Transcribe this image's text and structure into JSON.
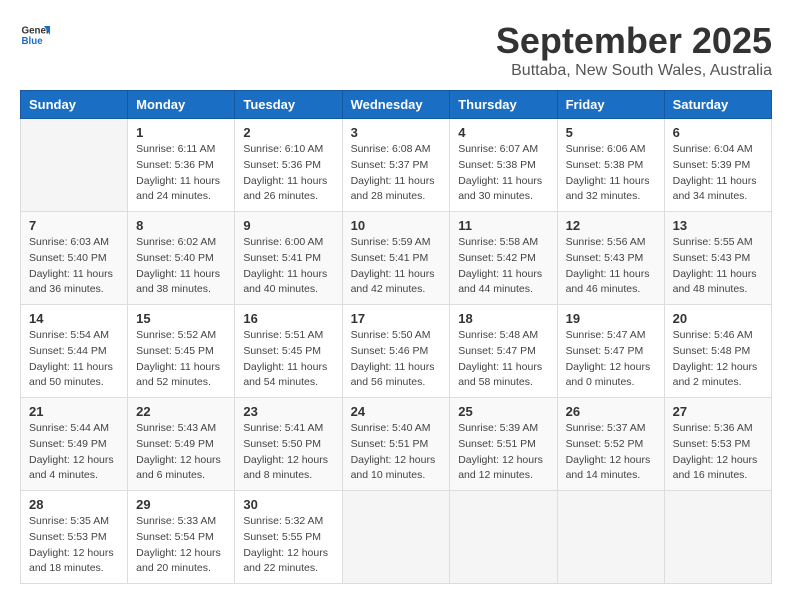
{
  "header": {
    "logo_general": "General",
    "logo_blue": "Blue",
    "month": "September 2025",
    "location": "Buttaba, New South Wales, Australia"
  },
  "weekdays": [
    "Sunday",
    "Monday",
    "Tuesday",
    "Wednesday",
    "Thursday",
    "Friday",
    "Saturday"
  ],
  "weeks": [
    [
      {
        "day": "",
        "sunrise": "",
        "sunset": "",
        "daylight": ""
      },
      {
        "day": "1",
        "sunrise": "Sunrise: 6:11 AM",
        "sunset": "Sunset: 5:36 PM",
        "daylight": "Daylight: 11 hours and 24 minutes."
      },
      {
        "day": "2",
        "sunrise": "Sunrise: 6:10 AM",
        "sunset": "Sunset: 5:36 PM",
        "daylight": "Daylight: 11 hours and 26 minutes."
      },
      {
        "day": "3",
        "sunrise": "Sunrise: 6:08 AM",
        "sunset": "Sunset: 5:37 PM",
        "daylight": "Daylight: 11 hours and 28 minutes."
      },
      {
        "day": "4",
        "sunrise": "Sunrise: 6:07 AM",
        "sunset": "Sunset: 5:38 PM",
        "daylight": "Daylight: 11 hours and 30 minutes."
      },
      {
        "day": "5",
        "sunrise": "Sunrise: 6:06 AM",
        "sunset": "Sunset: 5:38 PM",
        "daylight": "Daylight: 11 hours and 32 minutes."
      },
      {
        "day": "6",
        "sunrise": "Sunrise: 6:04 AM",
        "sunset": "Sunset: 5:39 PM",
        "daylight": "Daylight: 11 hours and 34 minutes."
      }
    ],
    [
      {
        "day": "7",
        "sunrise": "Sunrise: 6:03 AM",
        "sunset": "Sunset: 5:40 PM",
        "daylight": "Daylight: 11 hours and 36 minutes."
      },
      {
        "day": "8",
        "sunrise": "Sunrise: 6:02 AM",
        "sunset": "Sunset: 5:40 PM",
        "daylight": "Daylight: 11 hours and 38 minutes."
      },
      {
        "day": "9",
        "sunrise": "Sunrise: 6:00 AM",
        "sunset": "Sunset: 5:41 PM",
        "daylight": "Daylight: 11 hours and 40 minutes."
      },
      {
        "day": "10",
        "sunrise": "Sunrise: 5:59 AM",
        "sunset": "Sunset: 5:41 PM",
        "daylight": "Daylight: 11 hours and 42 minutes."
      },
      {
        "day": "11",
        "sunrise": "Sunrise: 5:58 AM",
        "sunset": "Sunset: 5:42 PM",
        "daylight": "Daylight: 11 hours and 44 minutes."
      },
      {
        "day": "12",
        "sunrise": "Sunrise: 5:56 AM",
        "sunset": "Sunset: 5:43 PM",
        "daylight": "Daylight: 11 hours and 46 minutes."
      },
      {
        "day": "13",
        "sunrise": "Sunrise: 5:55 AM",
        "sunset": "Sunset: 5:43 PM",
        "daylight": "Daylight: 11 hours and 48 minutes."
      }
    ],
    [
      {
        "day": "14",
        "sunrise": "Sunrise: 5:54 AM",
        "sunset": "Sunset: 5:44 PM",
        "daylight": "Daylight: 11 hours and 50 minutes."
      },
      {
        "day": "15",
        "sunrise": "Sunrise: 5:52 AM",
        "sunset": "Sunset: 5:45 PM",
        "daylight": "Daylight: 11 hours and 52 minutes."
      },
      {
        "day": "16",
        "sunrise": "Sunrise: 5:51 AM",
        "sunset": "Sunset: 5:45 PM",
        "daylight": "Daylight: 11 hours and 54 minutes."
      },
      {
        "day": "17",
        "sunrise": "Sunrise: 5:50 AM",
        "sunset": "Sunset: 5:46 PM",
        "daylight": "Daylight: 11 hours and 56 minutes."
      },
      {
        "day": "18",
        "sunrise": "Sunrise: 5:48 AM",
        "sunset": "Sunset: 5:47 PM",
        "daylight": "Daylight: 11 hours and 58 minutes."
      },
      {
        "day": "19",
        "sunrise": "Sunrise: 5:47 AM",
        "sunset": "Sunset: 5:47 PM",
        "daylight": "Daylight: 12 hours and 0 minutes."
      },
      {
        "day": "20",
        "sunrise": "Sunrise: 5:46 AM",
        "sunset": "Sunset: 5:48 PM",
        "daylight": "Daylight: 12 hours and 2 minutes."
      }
    ],
    [
      {
        "day": "21",
        "sunrise": "Sunrise: 5:44 AM",
        "sunset": "Sunset: 5:49 PM",
        "daylight": "Daylight: 12 hours and 4 minutes."
      },
      {
        "day": "22",
        "sunrise": "Sunrise: 5:43 AM",
        "sunset": "Sunset: 5:49 PM",
        "daylight": "Daylight: 12 hours and 6 minutes."
      },
      {
        "day": "23",
        "sunrise": "Sunrise: 5:41 AM",
        "sunset": "Sunset: 5:50 PM",
        "daylight": "Daylight: 12 hours and 8 minutes."
      },
      {
        "day": "24",
        "sunrise": "Sunrise: 5:40 AM",
        "sunset": "Sunset: 5:51 PM",
        "daylight": "Daylight: 12 hours and 10 minutes."
      },
      {
        "day": "25",
        "sunrise": "Sunrise: 5:39 AM",
        "sunset": "Sunset: 5:51 PM",
        "daylight": "Daylight: 12 hours and 12 minutes."
      },
      {
        "day": "26",
        "sunrise": "Sunrise: 5:37 AM",
        "sunset": "Sunset: 5:52 PM",
        "daylight": "Daylight: 12 hours and 14 minutes."
      },
      {
        "day": "27",
        "sunrise": "Sunrise: 5:36 AM",
        "sunset": "Sunset: 5:53 PM",
        "daylight": "Daylight: 12 hours and 16 minutes."
      }
    ],
    [
      {
        "day": "28",
        "sunrise": "Sunrise: 5:35 AM",
        "sunset": "Sunset: 5:53 PM",
        "daylight": "Daylight: 12 hours and 18 minutes."
      },
      {
        "day": "29",
        "sunrise": "Sunrise: 5:33 AM",
        "sunset": "Sunset: 5:54 PM",
        "daylight": "Daylight: 12 hours and 20 minutes."
      },
      {
        "day": "30",
        "sunrise": "Sunrise: 5:32 AM",
        "sunset": "Sunset: 5:55 PM",
        "daylight": "Daylight: 12 hours and 22 minutes."
      },
      {
        "day": "",
        "sunrise": "",
        "sunset": "",
        "daylight": ""
      },
      {
        "day": "",
        "sunrise": "",
        "sunset": "",
        "daylight": ""
      },
      {
        "day": "",
        "sunrise": "",
        "sunset": "",
        "daylight": ""
      },
      {
        "day": "",
        "sunrise": "",
        "sunset": "",
        "daylight": ""
      }
    ]
  ]
}
